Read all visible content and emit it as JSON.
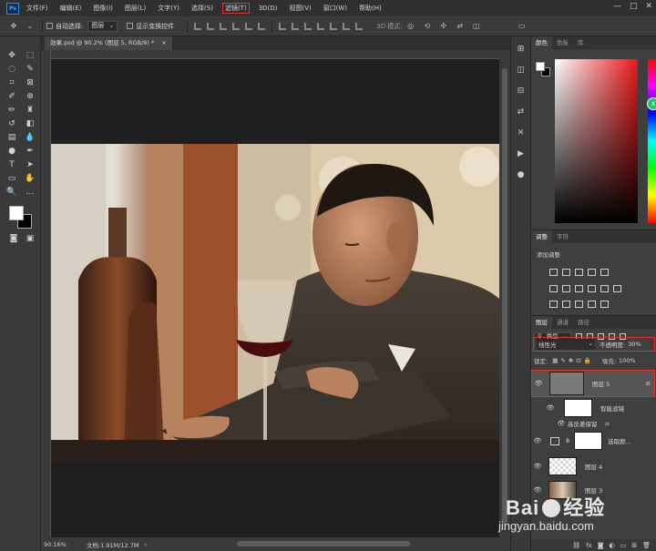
{
  "app": {
    "logo": "Ps",
    "menu": [
      "文件(F)",
      "编辑(E)",
      "图像(I)",
      "图层(L)",
      "文字(Y)",
      "选择(S)",
      "滤镜(T)",
      "3D(D)",
      "视图(V)",
      "窗口(W)",
      "帮助(H)"
    ],
    "active_menu_index": 6,
    "window_controls": [
      "—",
      "□",
      "✕"
    ]
  },
  "options": {
    "auto_select_label": "自动选择:",
    "auto_select_value": "图层",
    "show_transform_label": "显示变换控件",
    "mode_3d_label": "3D 模式:"
  },
  "document": {
    "tab_title": "效果.psd @ 90.2% (图层 5, RGB/8) *",
    "tab_close": "×",
    "status_zoom": "90.16%",
    "status_doc": "文档:1.91M/12.7M"
  },
  "color_panel": {
    "tabs": [
      "颜色",
      "色板",
      "库"
    ],
    "fg_color": "#ffffff",
    "bg_color": "#000000",
    "marker_text": "X"
  },
  "adjustments_panel": {
    "tabs": [
      "调整",
      "字符"
    ],
    "title": "添加调整"
  },
  "layers_panel": {
    "tabs": [
      "图层",
      "通道",
      "路径"
    ],
    "filter_label": "类型",
    "blend_mode": "线性光",
    "opacity_label": "不透明度:",
    "opacity_value": "30%",
    "lock_label": "锁定:",
    "fill_label": "填充:",
    "fill_value": "100%",
    "layers": [
      {
        "name": "图层 5",
        "selected": true
      },
      {
        "name": "智能滤镜"
      },
      {
        "name": "高反差保留"
      },
      {
        "name": "选取颜..."
      },
      {
        "name": "图层 4"
      },
      {
        "name": "图层 3"
      }
    ]
  },
  "watermark": {
    "brand": "Bai",
    "brand_cn": "经验",
    "url": "jingyan.baidu.com"
  }
}
